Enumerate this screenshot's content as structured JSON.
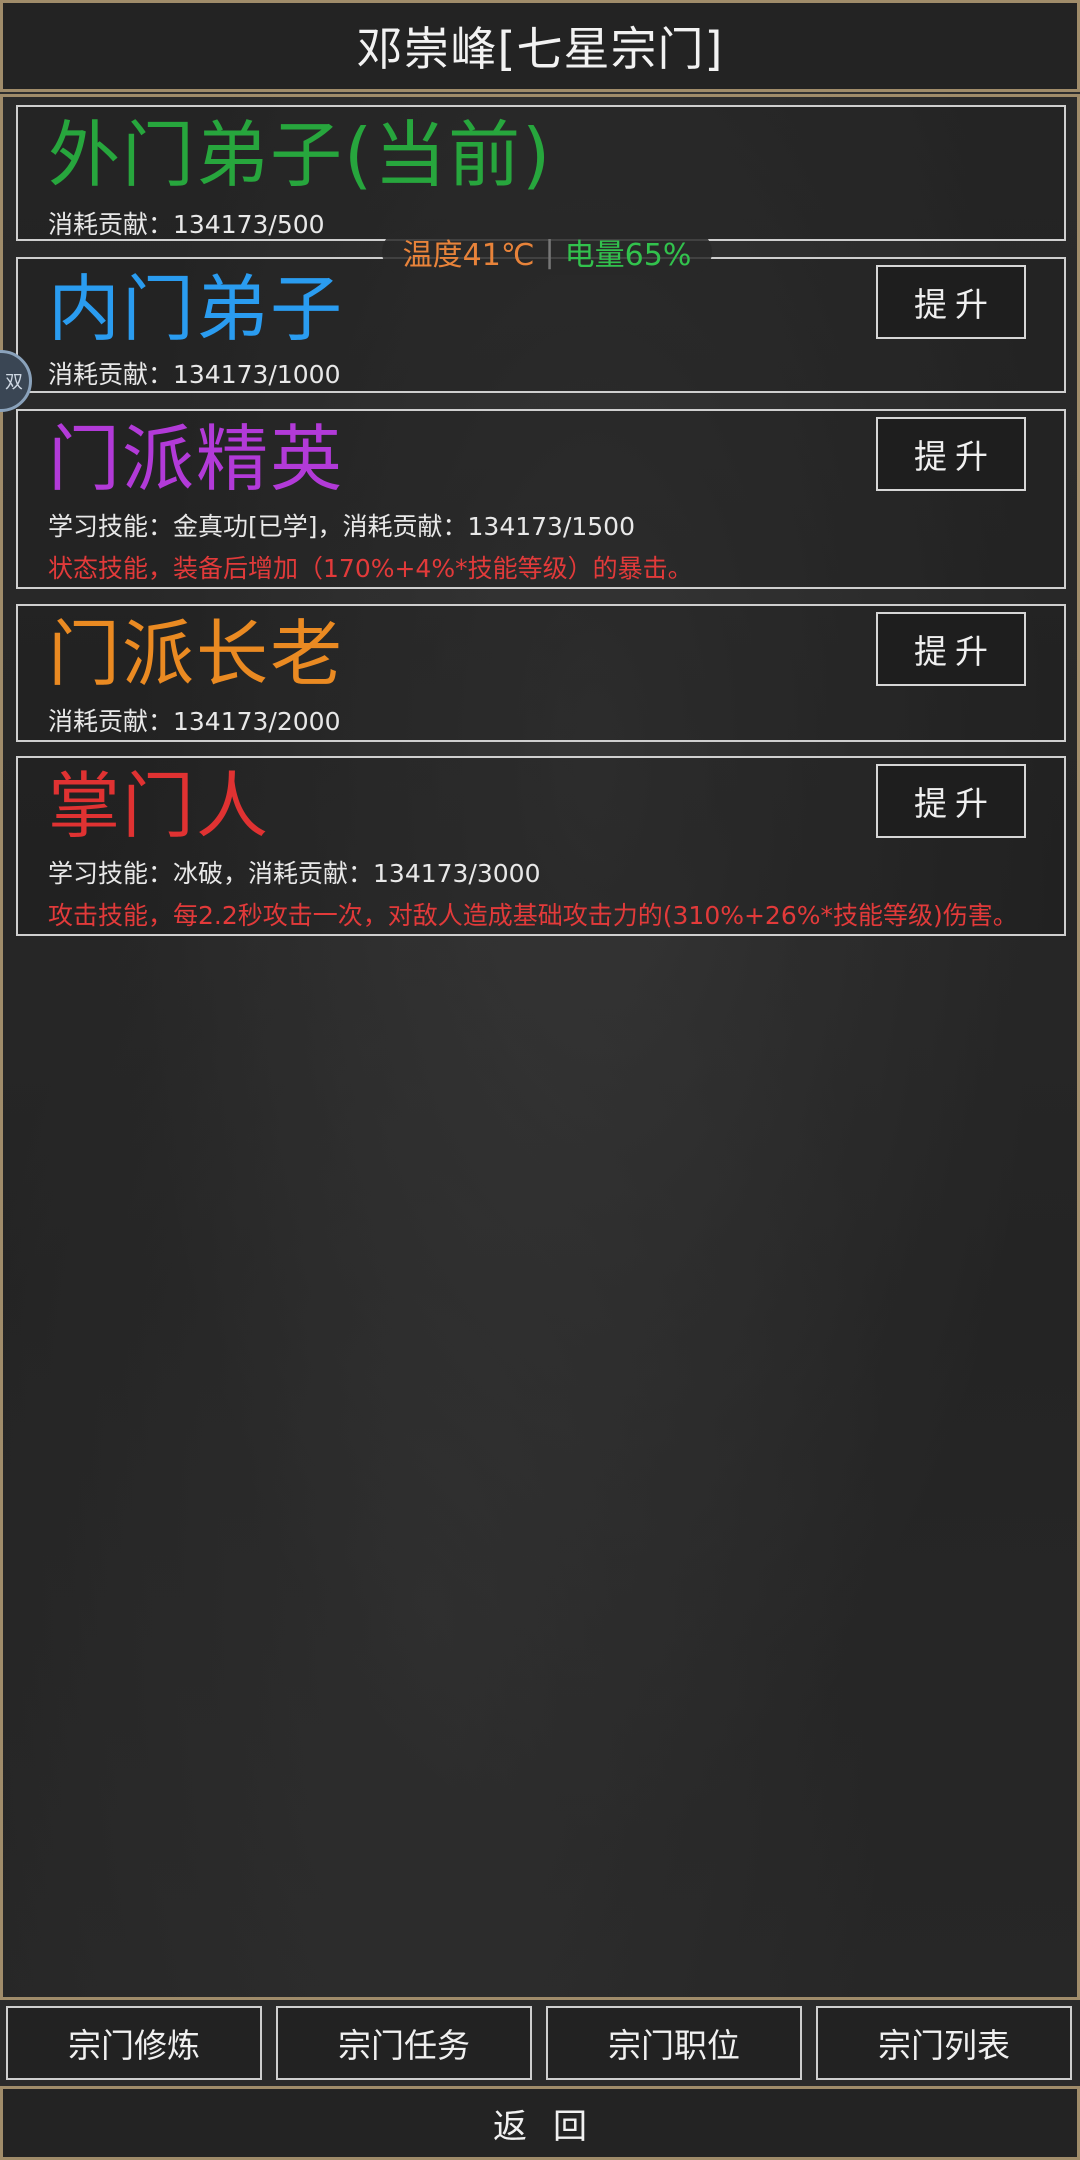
{
  "header": {
    "title": "邓崇峰[七星宗门]"
  },
  "status": {
    "temperature": "温度41℃",
    "battery": "电量65%"
  },
  "side_bubble": {
    "text": "双"
  },
  "ranks": [
    {
      "name": "外门弟子(当前)",
      "color": "#27a63d",
      "line": "消耗贡献：134173/500",
      "desc": "",
      "button": ""
    },
    {
      "name": "内门弟子",
      "color": "#2a9cf0",
      "line": "消耗贡献：134173/1000",
      "desc": "",
      "button": "提升"
    },
    {
      "name": "门派精英",
      "color": "#b23ad8",
      "line": "学习技能：金真功[已学]，消耗贡献：134173/1500",
      "desc": "状态技能，装备后增加（170%+4%*技能等级）的暴击。",
      "button": "提升"
    },
    {
      "name": "门派长老",
      "color": "#ea8a22",
      "line": "消耗贡献：134173/2000",
      "desc": "",
      "button": "提升"
    },
    {
      "name": "掌门人",
      "color": "#e03232",
      "line": "学习技能：冰破，消耗贡献：134173/3000",
      "desc": "攻击技能，每2.2秒攻击一次，对敌人造成基础攻击力的(310%+26%*技能等级)伤害。",
      "button": "提升"
    }
  ],
  "tabs": [
    "宗门修炼",
    "宗门任务",
    "宗门职位",
    "宗门列表"
  ],
  "footer": {
    "back": "返回"
  },
  "colors": {
    "frame": "#a08c6a",
    "desc_red": "#e23a3a"
  }
}
